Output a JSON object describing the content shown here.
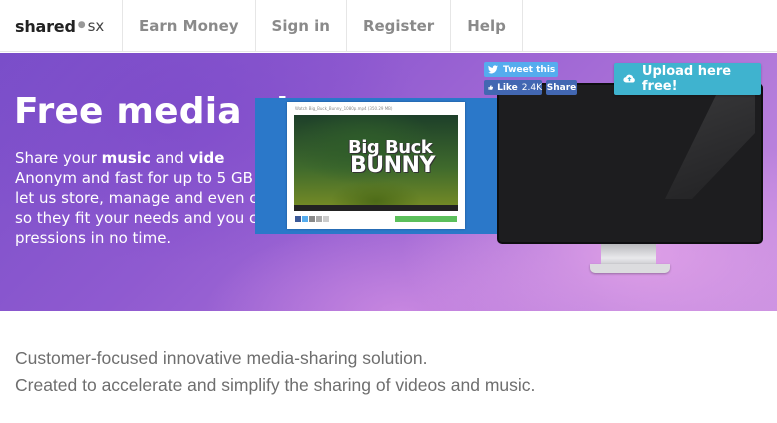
{
  "logo": {
    "primary": "shared",
    "secondary": "sx"
  },
  "nav": {
    "items": [
      {
        "label": "Earn Money"
      },
      {
        "label": "Sign in"
      },
      {
        "label": "Register"
      },
      {
        "label": "Help"
      }
    ]
  },
  "hero": {
    "title": "Free media sh",
    "text": {
      "l1a": "Share your ",
      "l1b": "music",
      "l1c": " and ",
      "l1d": "vide",
      "l2": "Anonym and fast for up to 5 GB",
      "l3": "let us store, manage and even c",
      "l4": "so they fit your needs and you car",
      "l5": "pressions in no time."
    }
  },
  "preview": {
    "caption": "Watch Big_Buck_Bunny_1080p.mp4 (350.29 MB)",
    "title_line1": "Big Buck",
    "title_line2": "BUNNY"
  },
  "social": {
    "tweet": "Tweet this",
    "like": "Like",
    "like_count": "2.4K",
    "share": "Share"
  },
  "upload": {
    "label": "Upload here free!"
  },
  "tagline": {
    "line1": "Customer-focused innovative media-sharing solution.",
    "line2": "Created to accelerate and simplify the sharing of videos and music."
  },
  "colors": {
    "accent": "#3fb3cf",
    "hero_start": "#7a4fc9",
    "hero_end": "#c68ee0",
    "twitter": "#55acee",
    "facebook": "#4267b2"
  }
}
